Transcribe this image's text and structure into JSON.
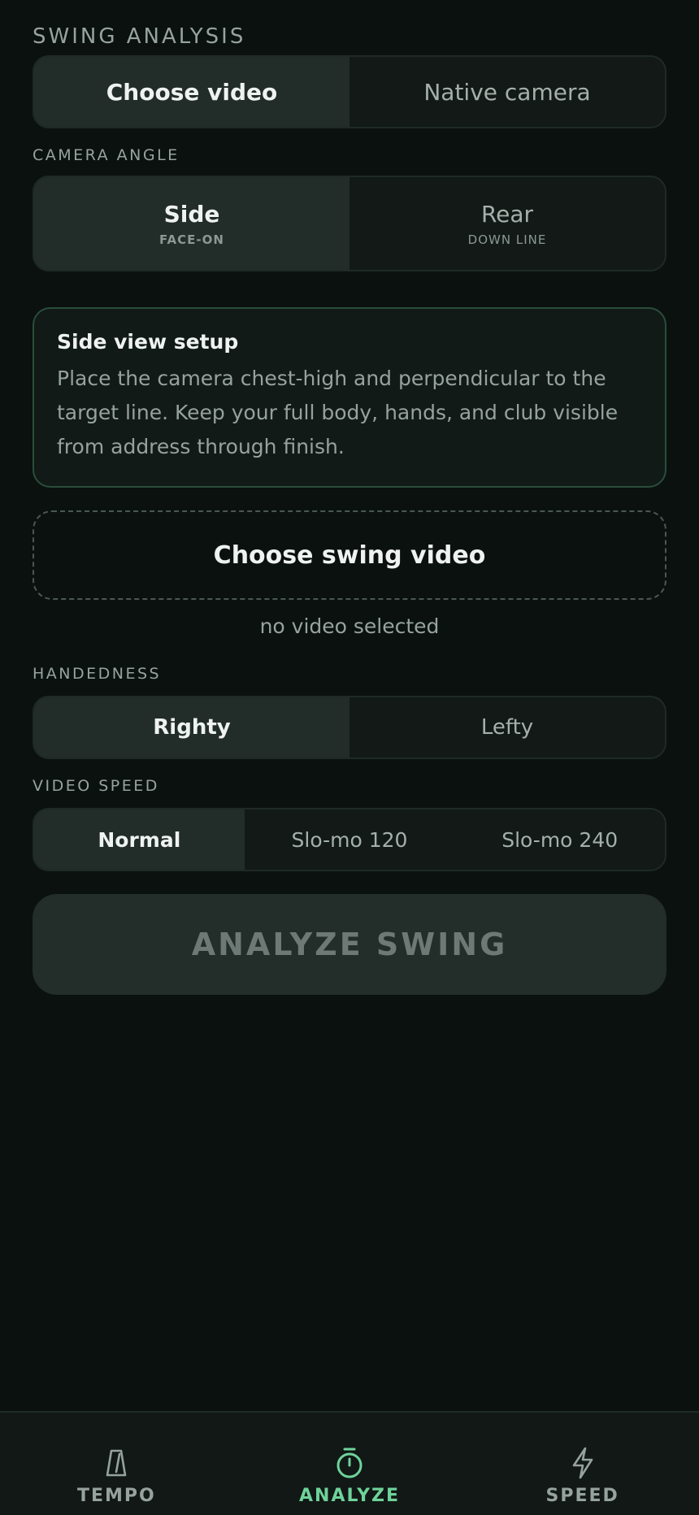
{
  "header": {
    "title": "SWING ANALYSIS"
  },
  "source": {
    "options": [
      {
        "label": "Choose video",
        "active": true
      },
      {
        "label": "Native camera",
        "active": false
      }
    ]
  },
  "camera_angle": {
    "label": "CAMERA ANGLE",
    "options": [
      {
        "label": "Side",
        "sub": "FACE-ON",
        "active": true
      },
      {
        "label": "Rear",
        "sub": "DOWN LINE",
        "active": false
      }
    ]
  },
  "setup_card": {
    "title": "Side view setup",
    "body": "Place the camera chest-high and perpendicular to the target line. Keep your full body, hands, and club visible from address through finish."
  },
  "upload": {
    "button_label": "Choose swing video",
    "status": "no video selected"
  },
  "handedness": {
    "label": "HANDEDNESS",
    "options": [
      {
        "label": "Righty",
        "active": true
      },
      {
        "label": "Lefty",
        "active": false
      }
    ]
  },
  "video_speed": {
    "label": "VIDEO SPEED",
    "options": [
      {
        "label": "Normal",
        "active": true
      },
      {
        "label": "Slo-mo 120",
        "active": false
      },
      {
        "label": "Slo-mo 240",
        "active": false
      }
    ]
  },
  "analyze_button": {
    "label": "ANALYZE SWING"
  },
  "nav": {
    "items": [
      {
        "label": "TEMPO",
        "icon": "metronome-icon",
        "active": false
      },
      {
        "label": "ANALYZE",
        "icon": "stopwatch-icon",
        "active": true
      },
      {
        "label": "SPEED",
        "icon": "lightning-icon",
        "active": false
      }
    ]
  },
  "colors": {
    "background": "#0b110f",
    "accent": "#6ed39a",
    "active_segment": "#222c29"
  }
}
